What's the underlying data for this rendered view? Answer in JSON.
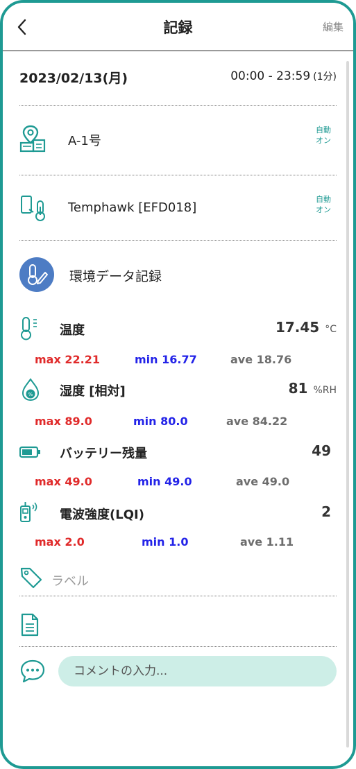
{
  "header": {
    "title": "記録",
    "edit_label": "編集"
  },
  "record": {
    "date": "2023/02/13(月)",
    "time_range": "00:00 - 23:59",
    "interval": "(1分)"
  },
  "location": {
    "name": "A-1号",
    "auto_line1": "自動",
    "auto_line2": "オン",
    "icon": "location-building-icon"
  },
  "device": {
    "name": "Temphawk [EFD018]",
    "auto_line1": "自動",
    "auto_line2": "オン",
    "icon": "phone-thermometer-icon"
  },
  "environment": {
    "label": "環境データ記録",
    "icon": "thermometer-pen-icon",
    "color": "#4d7cc4"
  },
  "measurements": [
    {
      "name": "温度",
      "value": "17.45",
      "unit": "°C",
      "max": "max 22.21",
      "min": "min 16.77",
      "ave": "ave 18.76",
      "icon": "thermometer-icon"
    },
    {
      "name": "湿度 [相対]",
      "value": "81",
      "unit": "%RH",
      "max": "max 89.0",
      "min": "min 80.0",
      "ave": "ave 84.22",
      "icon": "humidity-drop-icon"
    },
    {
      "name": "バッテリー残量",
      "value": "49",
      "unit": "",
      "max": "max 49.0",
      "min": "min 49.0",
      "ave": "ave 49.0",
      "icon": "battery-icon"
    },
    {
      "name": "電波強度(LQI)",
      "value": "2",
      "unit": "",
      "max": "max 2.0",
      "min": "min 1.0",
      "ave": "ave 1.11",
      "icon": "signal-device-icon"
    }
  ],
  "label_field": {
    "placeholder": "ラベル",
    "icon": "tag-icon"
  },
  "document": {
    "icon": "document-icon"
  },
  "comment": {
    "placeholder": "コメントの入力...",
    "icon": "chat-bubble-icon"
  },
  "colors": {
    "accent": "#1e9a93",
    "max": "#e02a2a",
    "min": "#2323e8",
    "ave": "#6d6d6d",
    "comment_bg": "#cdeee7"
  }
}
